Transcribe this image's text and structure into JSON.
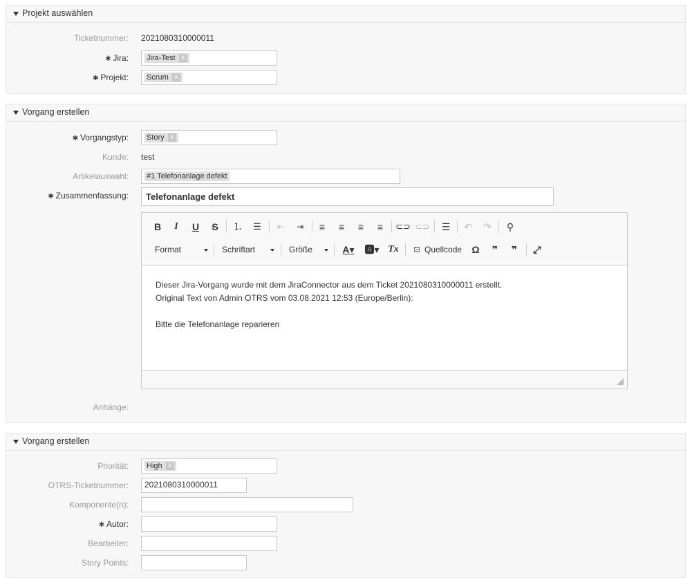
{
  "section1": {
    "title": "Projekt auswählen",
    "ticket_label": "Ticketnummer:",
    "ticket_value": "2021080310000011",
    "jira_label": "Jira:",
    "jira_value": "Jira-Test",
    "projekt_label": "Projekt:",
    "projekt_value": "Scrum"
  },
  "section2": {
    "title": "Vorgang erstellen",
    "vorgangstyp_label": "Vorgangstyp:",
    "vorgangstyp_value": "Story",
    "kunde_label": "Kunde:",
    "kunde_value": "test",
    "artikel_label": "Artikelauswahl:",
    "artikel_value": "#1 Telefonanlage defekt",
    "zusammenfassung_label": "Zusammenfassung:",
    "zusammenfassung_value": "Telefonanlage defekt",
    "anhaenge_label": "Anhänge:",
    "editor": {
      "format": "Format",
      "schriftart": "Schriftart",
      "groesse": "Größe",
      "quellcode": "Quellcode",
      "line1": "Dieser Jira-Vorgang wurde mit dem JiraConnector aus dem Ticket 2021080310000011 erstellt.",
      "line2": "Original Text von Admin OTRS vom 03.08.2021 12:53 (Europe/Berlin):",
      "line3": "Bitte die Telefonanlage reparieren"
    }
  },
  "section3": {
    "title": "Vorgang erstellen",
    "prioritaet_label": "Priorität:",
    "prioritaet_value": "High",
    "otrs_label": "OTRS-Ticketnummer:",
    "otrs_value": "2021080310000011",
    "komponente_label": "Komponente(n):",
    "autor_label": "Autor:",
    "bearbeiter_label": "Bearbeiter:",
    "storypoints_label": "Story Points:"
  },
  "required_marker": "∗",
  "tag_remove": "x"
}
